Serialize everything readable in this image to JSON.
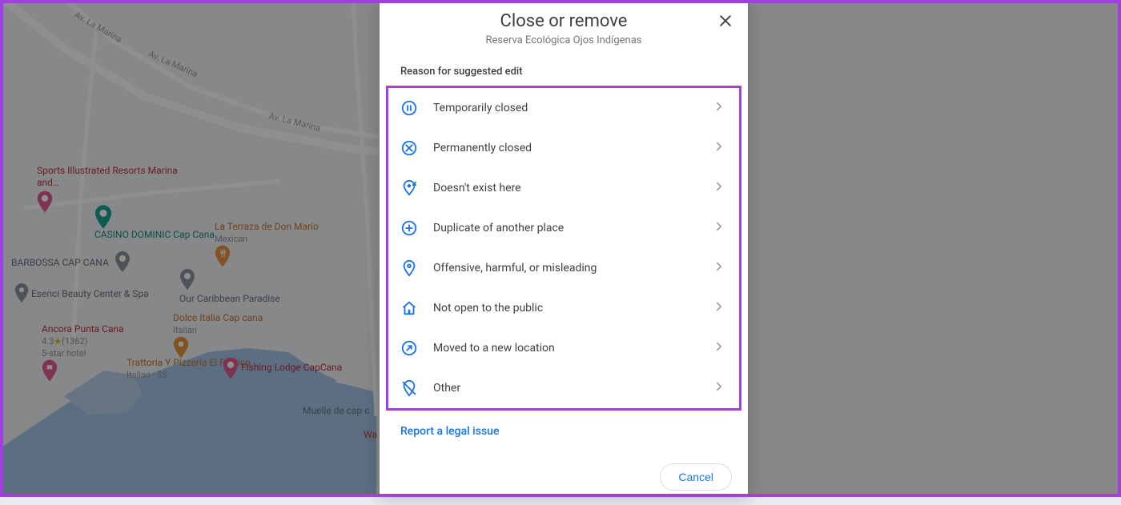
{
  "dialog": {
    "title": "Close or remove",
    "subtitle": "Reserva Ecológica Ojos Indígenas",
    "section_label": "Reason for suggested edit",
    "legal_link": "Report a legal issue",
    "cancel": "Cancel"
  },
  "reasons": [
    {
      "icon": "pause-icon",
      "label": "Temporarily closed"
    },
    {
      "icon": "closed-icon",
      "label": "Permanently closed"
    },
    {
      "icon": "not-here-icon",
      "label": "Doesn't exist here"
    },
    {
      "icon": "duplicate-icon",
      "label": "Duplicate of another place"
    },
    {
      "icon": "offensive-icon",
      "label": "Offensive, harmful, or misleading"
    },
    {
      "icon": "private-icon",
      "label": "Not open to the public"
    },
    {
      "icon": "moved-icon",
      "label": "Moved to a new location"
    },
    {
      "icon": "other-icon",
      "label": "Other"
    }
  ],
  "map": {
    "roads": [
      "Av. La Marina",
      "Av. La Marina",
      "Av. La Marina"
    ],
    "pois": {
      "casino": {
        "name": "CASINO DOMINIC Cap Cana"
      },
      "sports": {
        "name": "Sports Illustrated Resorts Marina and…"
      },
      "barbossa": {
        "name": "BARBOSSA CAP CANA"
      },
      "esenci": {
        "name": "Esenci Beauty Center & Spa"
      },
      "terraza": {
        "name": "La Terraza de Don Mario",
        "sub": "Mexican"
      },
      "caribbean": {
        "name": "Our Caribbean Paradise"
      },
      "dolce": {
        "name": "Dolce Italia Cap cana",
        "sub": "Italian"
      },
      "ancora": {
        "name": "Ancora Punta Cana",
        "rating": "4.3",
        "reviews": "(1362)",
        "sub": "5-star hotel"
      },
      "trattoria": {
        "name": "Trattoria Y Pizzeria El Pórtico",
        "sub": "Italian · $$"
      },
      "fishing": {
        "name": "Fishing Lodge CapCana"
      },
      "muelle": {
        "name": "Muelle de cap c"
      },
      "wa": {
        "name": "Wa"
      }
    }
  }
}
